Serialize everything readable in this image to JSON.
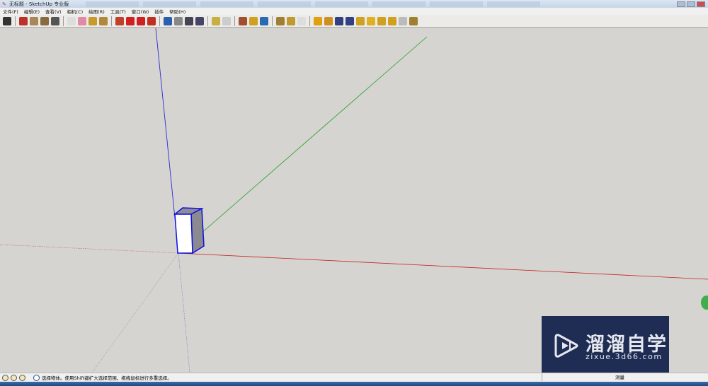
{
  "window": {
    "title": "无标题 - SketchUp 专业版"
  },
  "menu": [
    "文件(F)",
    "编辑(E)",
    "查看(V)",
    "相机(C)",
    "绘图(R)",
    "工具(T)",
    "窗口(W)",
    "插件",
    "帮助(H)"
  ],
  "toolbar": {
    "groups": [
      [
        {
          "icon": "select-icon",
          "color": "#333"
        }
      ],
      [
        {
          "icon": "pencil-icon",
          "color": "#c0302a"
        },
        {
          "icon": "rectangle-icon",
          "color": "#a8875a"
        },
        {
          "icon": "circle-icon",
          "color": "#8a6a40"
        },
        {
          "icon": "arc-icon",
          "color": "#555"
        }
      ],
      [
        {
          "icon": "make-component-icon",
          "color": "#ddd"
        },
        {
          "icon": "eraser-icon",
          "color": "#e08aa8"
        },
        {
          "icon": "tape-measure-icon",
          "color": "#c79a2e"
        },
        {
          "icon": "paint-bucket-icon",
          "color": "#b08a3a"
        }
      ],
      [
        {
          "icon": "push-pull-icon",
          "color": "#c0402a"
        },
        {
          "icon": "move-icon",
          "color": "#d02020"
        },
        {
          "icon": "rotate-icon",
          "color": "#d02020"
        },
        {
          "icon": "follow-me-icon",
          "color": "#c03020"
        }
      ],
      [
        {
          "icon": "orbit-icon",
          "color": "#2a5fb0"
        },
        {
          "icon": "pan-icon",
          "color": "#888"
        },
        {
          "icon": "zoom-icon",
          "color": "#445"
        },
        {
          "icon": "zoom-extents-icon",
          "color": "#446"
        }
      ],
      [
        {
          "icon": "3d-warehouse-icon",
          "color": "#c8b040"
        },
        {
          "icon": "share-model-icon",
          "color": "#ccc"
        }
      ],
      [
        {
          "icon": "get-models-icon",
          "color": "#a05030"
        },
        {
          "icon": "section-plane-icon",
          "color": "#d0a020"
        },
        {
          "icon": "google-earth-icon",
          "color": "#2a6ab0"
        }
      ],
      [
        {
          "icon": "components-icon",
          "color": "#a08030"
        },
        {
          "icon": "materials-icon",
          "color": "#c09a30"
        },
        {
          "icon": "styles-icon",
          "color": "#ddd"
        }
      ],
      [
        {
          "icon": "sandbox-icon",
          "color": "#e0a010"
        },
        {
          "icon": "sandbox-scratch-icon",
          "color": "#d09020"
        },
        {
          "icon": "sandbox-smoove-icon",
          "color": "#304080"
        },
        {
          "icon": "sandbox-stamp-icon",
          "color": "#304080"
        },
        {
          "icon": "sandbox-drape-icon",
          "color": "#d0a020"
        },
        {
          "icon": "sandbox-detail-icon",
          "color": "#e0b020"
        },
        {
          "icon": "sandbox-flip-icon",
          "color": "#d0a020"
        },
        {
          "icon": "sandbox-add-icon",
          "color": "#d0a020"
        },
        {
          "icon": "sandbox-point-icon",
          "color": "#bbb"
        },
        {
          "icon": "sandbox-edge-icon",
          "color": "#a08030"
        }
      ]
    ]
  },
  "status": {
    "hint": "选择物体。使用Shift键扩大选择范围，拖拽鼠标进行多重选择。",
    "measure_label": "测量"
  },
  "watermark": {
    "name": "溜溜自学",
    "url": "zixue.3d66.com"
  },
  "colors": {
    "x_axis": "#d02020",
    "y_axis": "#20a020",
    "z_axis": "#2020d0",
    "viewport": "#d5d4d0"
  }
}
